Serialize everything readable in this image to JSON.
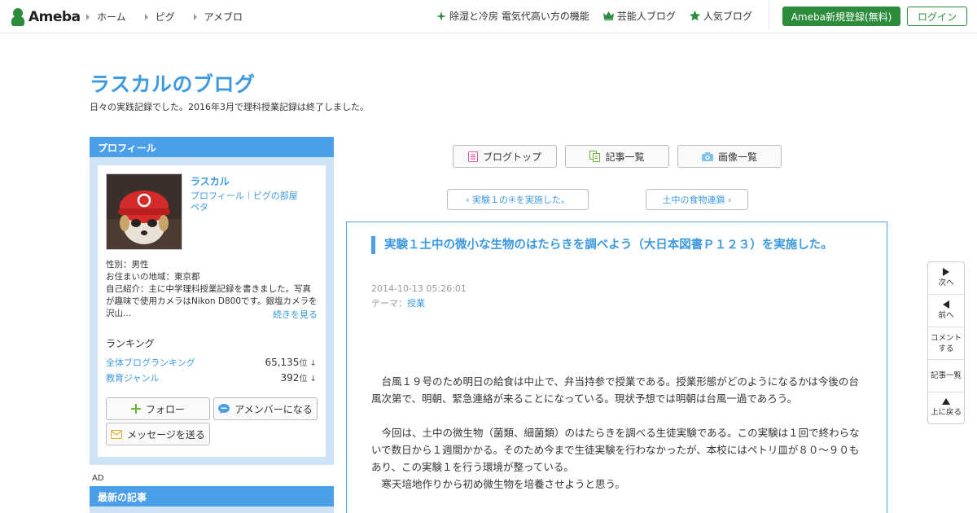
{
  "header": {
    "logo_text": "Ameba",
    "nav": [
      "ホーム",
      "ピグ",
      "アメブロ"
    ],
    "links": [
      {
        "icon": "sparkle-icon",
        "label": "除湿と冷房 電気代高い方の機能"
      },
      {
        "icon": "crown-icon",
        "label": "芸能人ブログ"
      },
      {
        "icon": "star-icon",
        "label": "人気ブログ"
      }
    ],
    "register_label": "Ameba新規登録(無料)",
    "login_label": "ログイン"
  },
  "blog": {
    "title": "ラスカルのブログ",
    "description": "日々の実践記録でした。2016年3月で理科授業記録は終了しました。"
  },
  "profile": {
    "heading": "プロフィール",
    "name": "ラスカル",
    "link_profile": "プロフィール",
    "link_separator": "｜",
    "link_room": "ピグの部屋",
    "peta": "ペタ",
    "gender": "性別：男性",
    "region": "お住まいの地域：東京都",
    "intro": "自己紹介：主に中学理科授業記録を書きました。写真が趣味で使用カメラはNikon D800です。銀塩カメラを沢山...",
    "more": "続きを見る",
    "ranking_heading": "ランキング",
    "rankings": [
      {
        "label": "全体ブログランキング",
        "value": "65,135",
        "unit": "位 ↓"
      },
      {
        "label": "教育ジャンル",
        "value": "392",
        "unit": "位 ↓"
      }
    ],
    "follow": "フォロー",
    "amember": "アメンバーになる",
    "message": "メッセージを送る"
  },
  "sidebar": {
    "ad": "AD",
    "recent_heading": "最新の記事"
  },
  "main_nav": {
    "blog_top": "ブログトップ",
    "article_list": "記事一覧",
    "image_list": "画像一覧",
    "prev_article": "実験１の④を実施した。",
    "next_article": "土中の食物連鎖"
  },
  "article": {
    "title": "実験１土中の微小な生物のはたらきを調べよう（大日本図書Ｐ１２３）を実施した。",
    "date": "2014-10-13 05:26:01",
    "theme_label": "テーマ：",
    "theme": "授業",
    "paragraphs": [
      "　台風１９号のため明日の給食は中止で、弁当持参で授業である。授業形態がどのようになるかは今後の台風次第で、明朝、緊急連絡が来ることになっている。現状予想では明朝は台風一過であろう。",
      "",
      "　今回は、土中の微生物（菌類、細菌類）のはたらきを調べる生徒実験である。この実験は１回で終わらないで数日から１週間かかる。そのため今まで生徒実験を行わなかったが、本校にはペトリ皿が８０～９０もあり、この実験１を行う環境が整っている。",
      "　寒天培地作りから初め微生物を培養させようと思う。"
    ]
  },
  "float_nav": {
    "next": "次へ",
    "prev": "前へ",
    "comment": "コメントする",
    "list": "記事一覧",
    "top": "上に戻る"
  },
  "colors": {
    "brand_green": "#2d8c3c",
    "accent_blue": "#3d99e0",
    "panel_blue": "#4a9fe8",
    "panel_light": "#cfe3f7"
  }
}
